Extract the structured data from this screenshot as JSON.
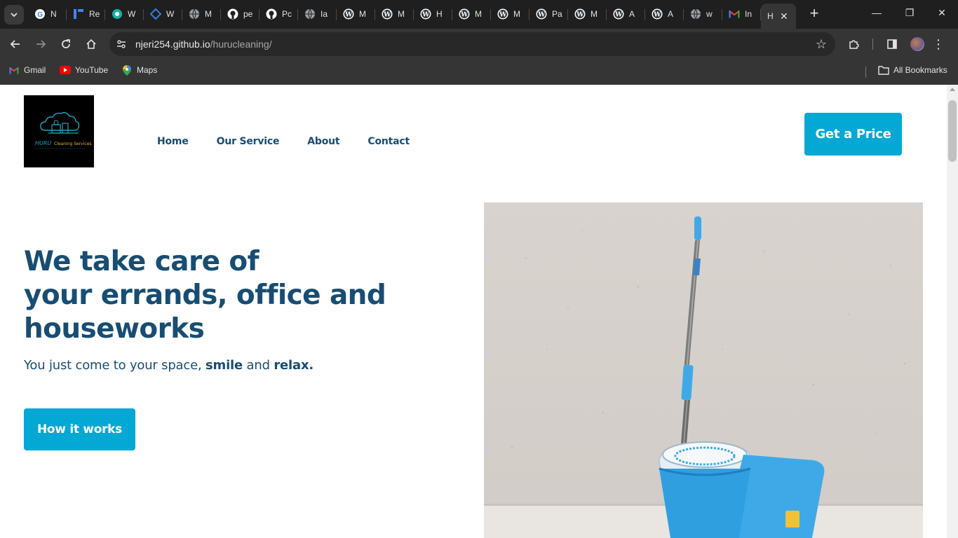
{
  "browser": {
    "tabs": [
      {
        "label": "N",
        "icon": "google-icon",
        "color": "#ffffff"
      },
      {
        "label": "Re",
        "icon": "roadmap-icon",
        "color": "#4285f4"
      },
      {
        "label": "W",
        "icon": "teal-circle-icon",
        "color": "#16b1a6"
      },
      {
        "label": "W",
        "icon": "diamond-icon",
        "color": "#3b7bdc"
      },
      {
        "label": "M",
        "icon": "globe-icon",
        "color": "#9aa0a6"
      },
      {
        "label": "pe",
        "icon": "github-icon",
        "color": "#ffffff"
      },
      {
        "label": "Pc",
        "icon": "github-icon",
        "color": "#ffffff"
      },
      {
        "label": "Ia",
        "icon": "globe-icon",
        "color": "#9aa0a6"
      },
      {
        "label": "M",
        "icon": "wordpress-icon",
        "color": "#ffffff"
      },
      {
        "label": "M",
        "icon": "wordpress-icon",
        "color": "#ffffff"
      },
      {
        "label": "H",
        "icon": "wordpress-icon",
        "color": "#ffffff"
      },
      {
        "label": "M",
        "icon": "wordpress-icon",
        "color": "#ffffff"
      },
      {
        "label": "M",
        "icon": "wordpress-icon",
        "color": "#ffffff"
      },
      {
        "label": "Pa",
        "icon": "wordpress-icon",
        "color": "#ffffff"
      },
      {
        "label": "M",
        "icon": "wordpress-icon",
        "color": "#ffffff"
      },
      {
        "label": "A",
        "icon": "wordpress-icon",
        "color": "#ffffff"
      },
      {
        "label": "A",
        "icon": "wordpress-icon",
        "color": "#ffffff"
      },
      {
        "label": "w",
        "icon": "globe-icon",
        "color": "#9aa0a6"
      },
      {
        "label": "In",
        "icon": "gmail-icon",
        "color": "#ea4335"
      }
    ],
    "active_tab": {
      "label": "H",
      "close": "✕"
    },
    "new_tab": "+",
    "window_controls": {
      "minimize": "—",
      "restore": "❐",
      "close": "✕"
    },
    "url_host": "njeri254.github.io",
    "url_path": "/hurucleaning/",
    "bookmarks": [
      {
        "label": "Gmail",
        "icon": "gmail-icon"
      },
      {
        "label": "YouTube",
        "icon": "youtube-icon"
      },
      {
        "label": "Maps",
        "icon": "maps-icon"
      }
    ],
    "all_bookmarks": "All Bookmarks"
  },
  "site": {
    "logo_text": "HURU Cleaning Services",
    "nav": [
      "Home",
      "Our Service",
      "About",
      "Contact"
    ],
    "cta": "Get a Price",
    "hero": {
      "title_lines": [
        "We take care of",
        "your errands, office and",
        "houseworks"
      ],
      "subtitle_parts": [
        "You just come to your space, ",
        "smile",
        " and ",
        "relax."
      ],
      "button": "How it works"
    },
    "image_subject": "mop-and-bucket-photo"
  },
  "colors": {
    "brand_dark": "#184d73",
    "accent": "#03a8d4"
  }
}
